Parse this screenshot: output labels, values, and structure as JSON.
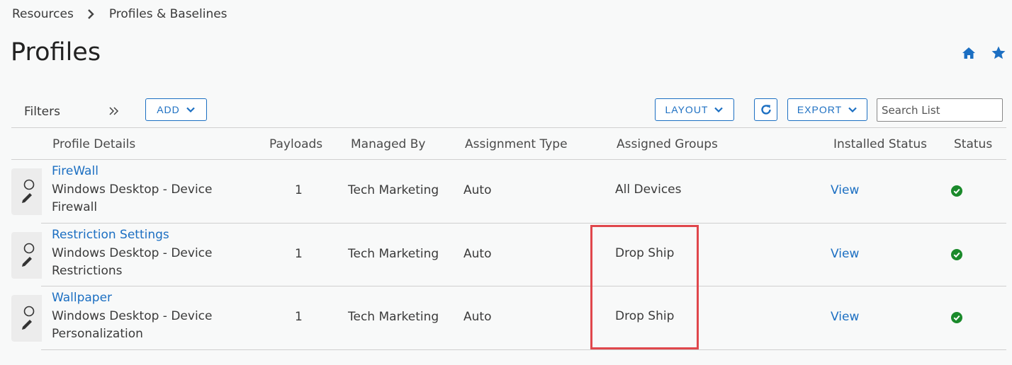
{
  "breadcrumb": {
    "parent": "Resources",
    "current": "Profiles & Baselines"
  },
  "page": {
    "title": "Profiles"
  },
  "toolbar": {
    "filters_label": "Filters",
    "add_label": "ADD",
    "layout_label": "LAYOUT",
    "export_label": "EXPORT",
    "search_placeholder": "Search List"
  },
  "table": {
    "columns": {
      "profile_details": "Profile Details",
      "payloads": "Payloads",
      "managed_by": "Managed By",
      "assignment_type": "Assignment Type",
      "assigned_groups": "Assigned Groups",
      "installed_status": "Installed Status",
      "status": "Status"
    },
    "rows": [
      {
        "name": "FireWall",
        "description": "Windows Desktop - Device Firewall",
        "payloads": "1",
        "managed_by": "Tech Marketing",
        "assignment_type": "Auto",
        "assigned_groups": "All Devices",
        "installed_status": "View"
      },
      {
        "name": "Restriction Settings",
        "description": "Windows Desktop - Device Restrictions",
        "payloads": "1",
        "managed_by": "Tech Marketing",
        "assignment_type": "Auto",
        "assigned_groups": "Drop Ship",
        "installed_status": "View"
      },
      {
        "name": "Wallpaper",
        "description": "Windows Desktop - Device Personalization",
        "payloads": "1",
        "managed_by": "Tech Marketing",
        "assignment_type": "Auto",
        "assigned_groups": "Drop Ship",
        "installed_status": "View"
      }
    ]
  },
  "colors": {
    "accent": "#1c6fc2",
    "status_ok": "#1a8a2b",
    "highlight": "#e0474c"
  }
}
